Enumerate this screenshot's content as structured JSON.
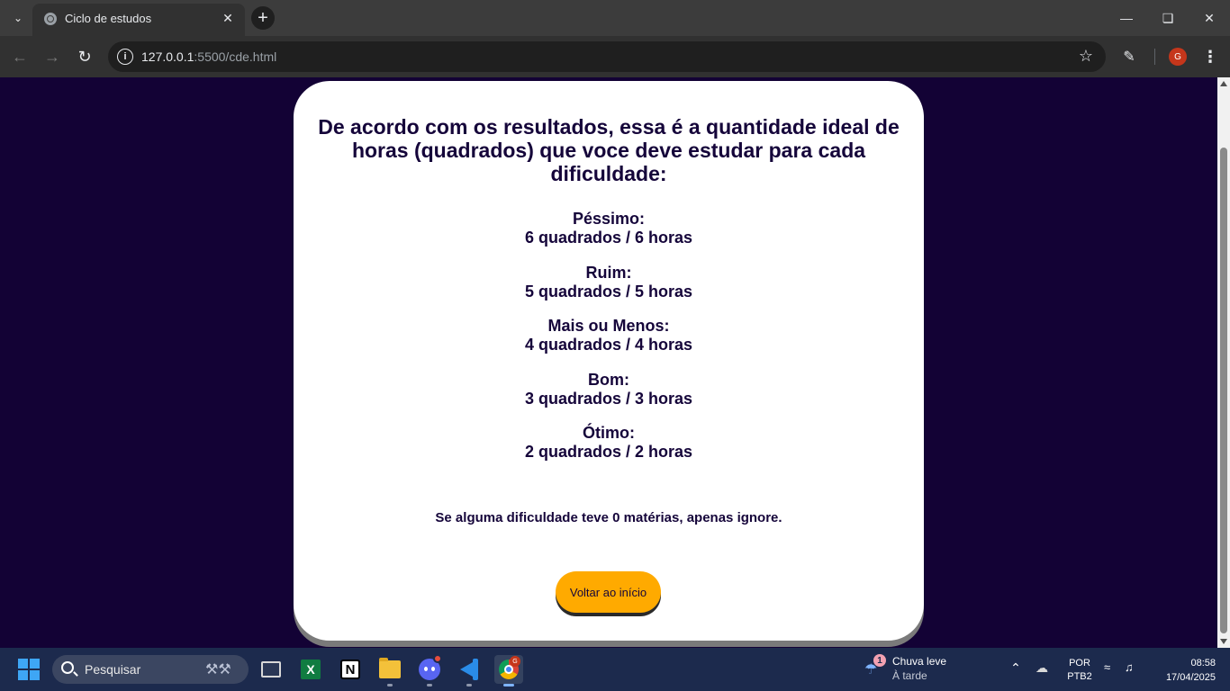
{
  "browser": {
    "tab_title": "Ciclo de estudos",
    "url_host": "127.0.0.1",
    "url_rest": ":5500/cde.html",
    "profile_initial": "G"
  },
  "page": {
    "title": "De acordo com os resultados, essa é a quantidade ideal de horas (quadrados) que voce deve estudar para cada dificuldade:",
    "difficulties": [
      {
        "label": "Péssimo:",
        "value": "6 quadrados / 6 horas"
      },
      {
        "label": "Ruim:",
        "value": "5 quadrados / 5 horas"
      },
      {
        "label": "Mais ou Menos:",
        "value": "4 quadrados / 4 horas"
      },
      {
        "label": "Bom:",
        "value": "3 quadrados / 3 horas"
      },
      {
        "label": "Ótimo:",
        "value": "2 quadrados / 2 horas"
      }
    ],
    "note": "Se alguma dificuldade teve 0 matérias, apenas ignore.",
    "back_button": "Voltar ao início"
  },
  "taskbar": {
    "search_placeholder": "Pesquisar",
    "weather_badge": "1",
    "weather_title": "Chuva leve",
    "weather_subtitle": "À tarde",
    "lang_primary": "POR",
    "lang_secondary": "PTB2",
    "time": "08:58",
    "date": "17/04/2025",
    "chrome_badge": "G"
  },
  "colors": {
    "page_background": "#130235",
    "card_background": "#ffffff",
    "text": "#15053a",
    "button": "#ffaa00",
    "taskbar": "#1c2a4d"
  }
}
